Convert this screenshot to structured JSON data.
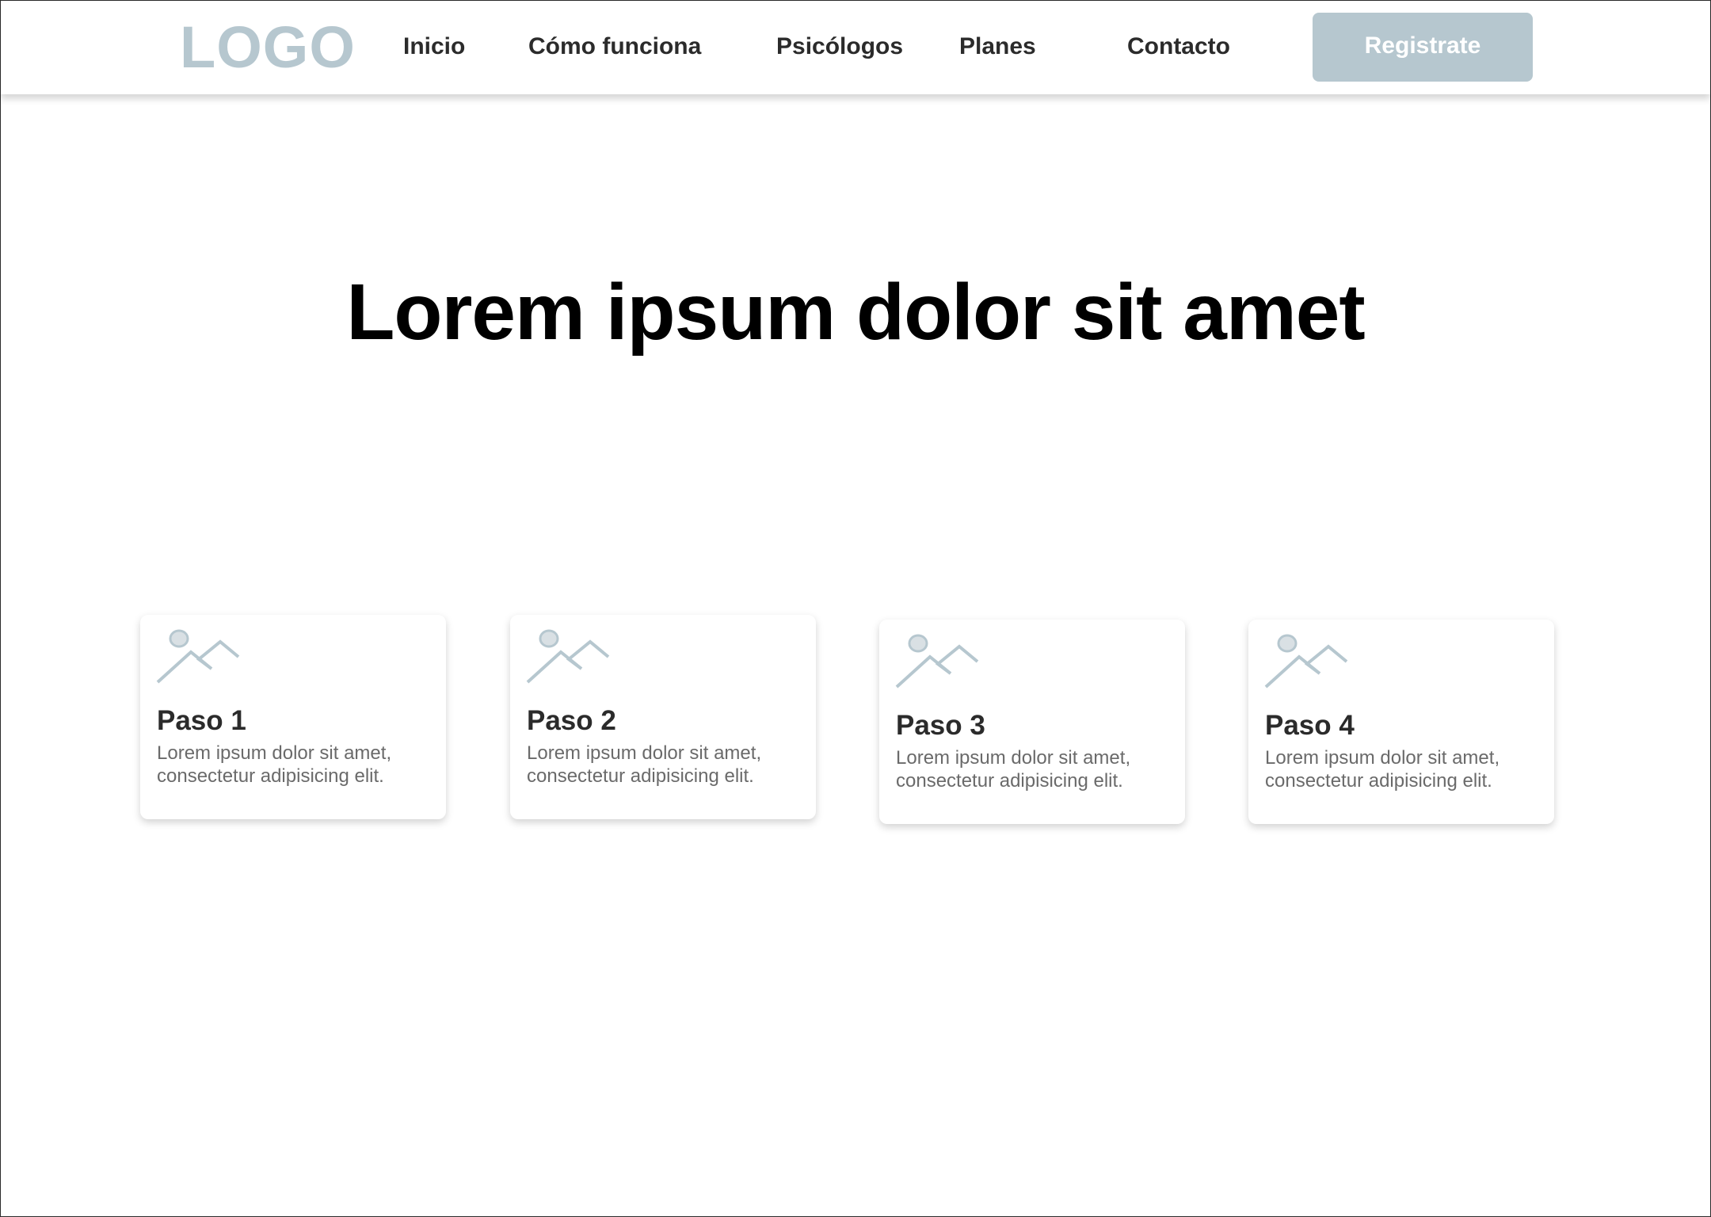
{
  "header": {
    "logo": "LOGO",
    "nav": [
      "Inicio",
      "Cómo funciona",
      "Psicólogos",
      "Planes",
      "Contacto"
    ],
    "cta_label": "Registrate"
  },
  "hero": {
    "title": "Lorem ipsum dolor sit amet"
  },
  "steps": [
    {
      "title": "Paso 1",
      "text": "Lorem ipsum dolor sit amet, consectetur adipisicing elit.",
      "icon": "image-placeholder-icon"
    },
    {
      "title": "Paso 2",
      "text": "Lorem ipsum dolor sit amet, consectetur adipisicing elit.",
      "icon": "image-placeholder-icon"
    },
    {
      "title": "Paso 3",
      "text": "Lorem ipsum dolor sit amet, consectetur adipisicing elit.",
      "icon": "image-placeholder-icon"
    },
    {
      "title": "Paso 4",
      "text": "Lorem ipsum dolor sit amet, consectetur adipisicing elit.",
      "icon": "image-placeholder-icon"
    }
  ],
  "colors": {
    "accent": "#b6c7cf",
    "text_dark": "#2b2b2b",
    "text_muted": "#6a6a6a"
  }
}
